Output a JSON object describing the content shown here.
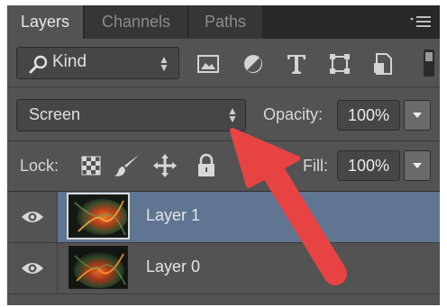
{
  "tabs": [
    {
      "label": "Layers",
      "active": true
    },
    {
      "label": "Channels",
      "active": false
    },
    {
      "label": "Paths",
      "active": false
    }
  ],
  "filter": {
    "kind_label": "Kind",
    "icons": [
      "image-filter-icon",
      "adjustment-filter-icon",
      "type-filter-icon",
      "shape-filter-icon",
      "smart-object-filter-icon"
    ]
  },
  "blend": {
    "mode": "Screen",
    "opacity_label": "Opacity:",
    "opacity_value": "100%"
  },
  "lock": {
    "label": "Lock:",
    "fill_label": "Fill:",
    "fill_value": "100%",
    "icons": [
      "lock-transparent-pixels-icon",
      "lock-image-pixels-icon",
      "lock-position-icon",
      "lock-all-icon"
    ]
  },
  "layers": [
    {
      "name": "Layer 1",
      "selected": true,
      "visible": true
    },
    {
      "name": "Layer 0",
      "selected": false,
      "visible": true
    }
  ],
  "colors": {
    "panel_bg": "#535353",
    "selected_row": "#5f7591",
    "annotation_arrow": "#e84343"
  }
}
